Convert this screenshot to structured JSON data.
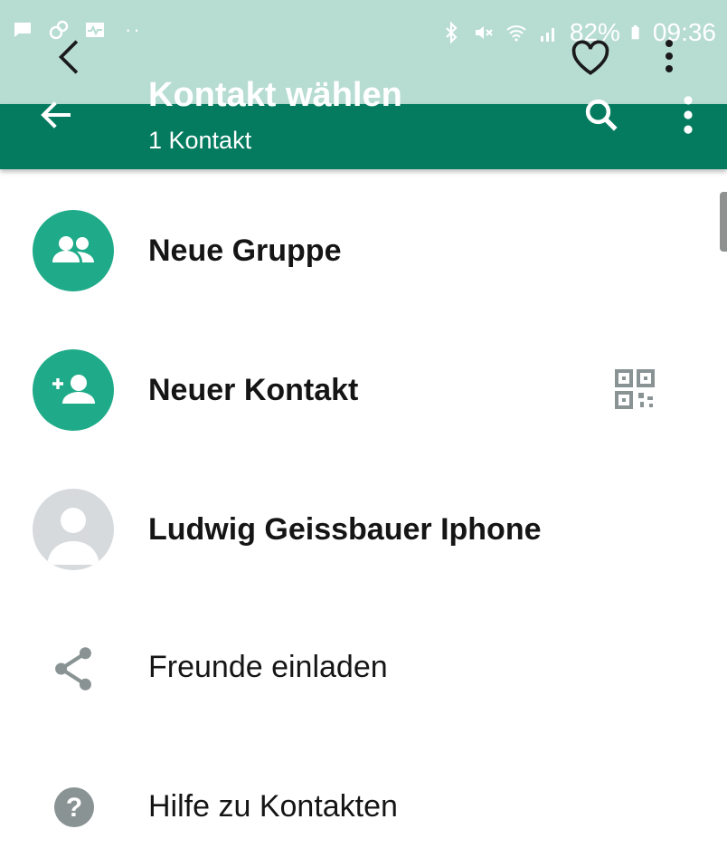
{
  "status_bar": {
    "left_icons": [
      "message-icon",
      "link-icon",
      "activity-icon"
    ],
    "right_icons": [
      "bluetooth-icon",
      "mute-icon",
      "wifi-icon",
      "signal-icon",
      "battery-icon"
    ],
    "battery": "82%",
    "time": "09:36"
  },
  "toolbar": {
    "title": "Kontakt wählen",
    "subtitle": "1 Kontakt"
  },
  "list": {
    "items": [
      {
        "label": "Neue Gruppe",
        "icon": "group-icon"
      },
      {
        "label": "Neuer Kontakt",
        "icon": "add-person-icon"
      },
      {
        "label": "Ludwig Geissbauer Iphone",
        "icon": "person-icon"
      },
      {
        "label": "Freunde einladen",
        "icon": "share-icon"
      },
      {
        "label": "Hilfe zu Kontakten",
        "icon": "help-icon"
      }
    ]
  },
  "colors": {
    "toolbar": "#047b5f",
    "accent": "#1fab89",
    "statusbar": "#b7dcd2"
  }
}
